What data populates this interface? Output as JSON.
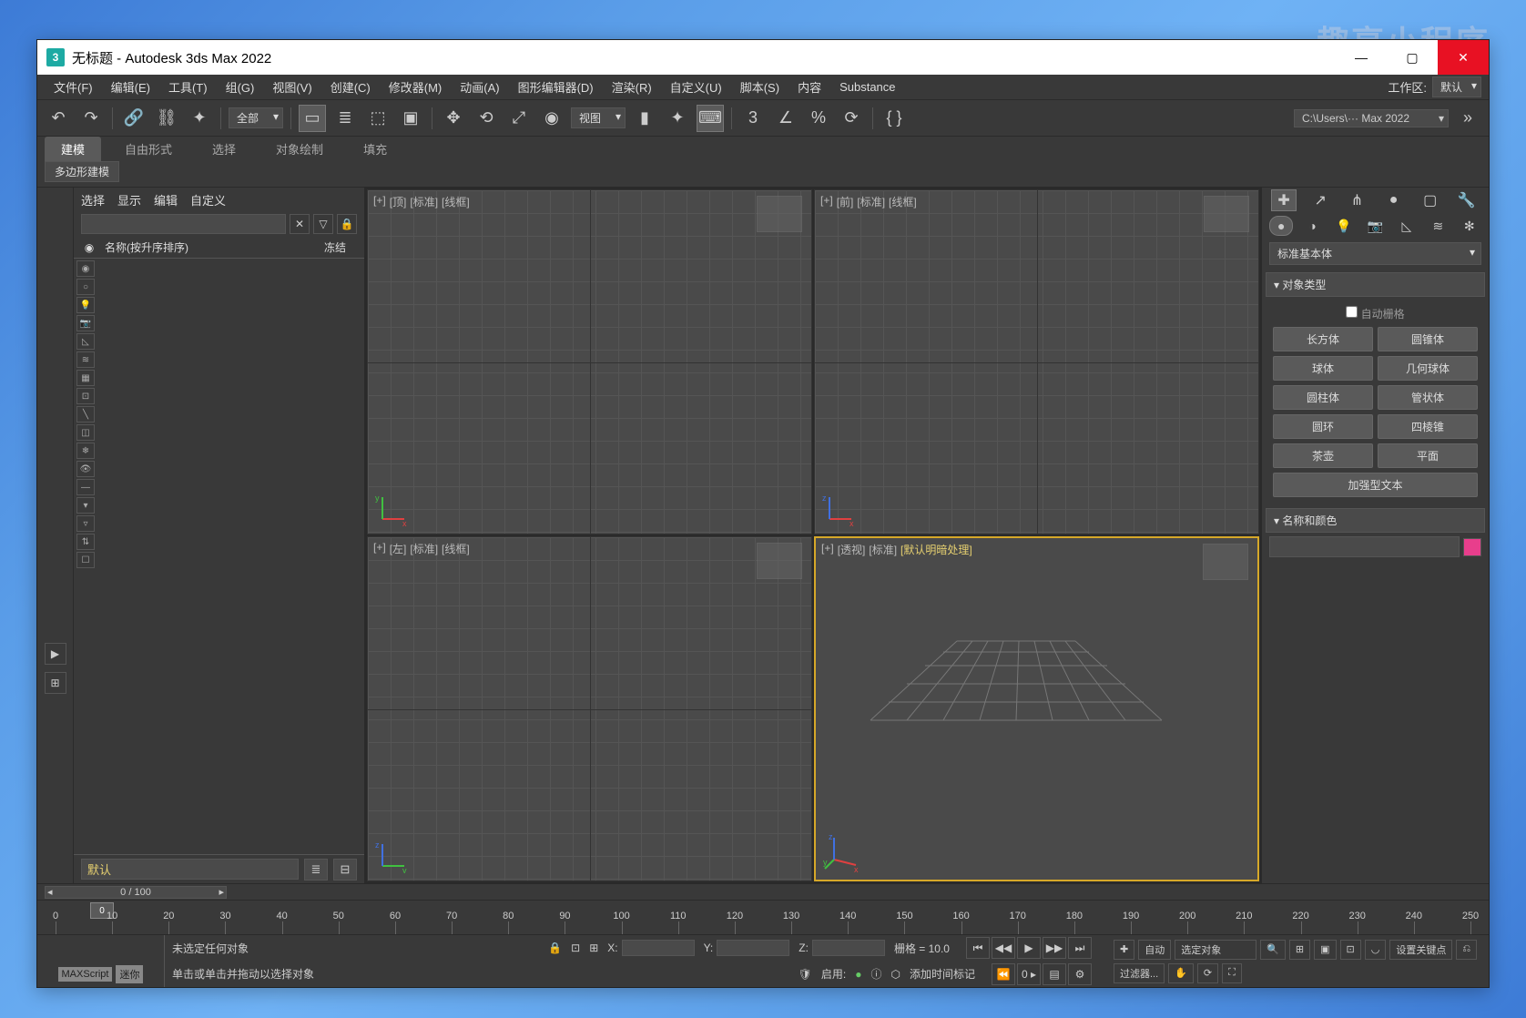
{
  "watermark": "趣享小程序",
  "window": {
    "title": "无标题 - Autodesk 3ds Max 2022"
  },
  "menubar": {
    "items": [
      "文件(F)",
      "编辑(E)",
      "工具(T)",
      "组(G)",
      "视图(V)",
      "创建(C)",
      "修改器(M)",
      "动画(A)",
      "图形编辑器(D)",
      "渲染(R)",
      "自定义(U)",
      "脚本(S)",
      "内容",
      "Substance"
    ],
    "workspace_label": "工作区:",
    "workspace_value": "默认"
  },
  "toolbar": {
    "selection_filter": "全部",
    "ref_coord": "视图",
    "angle_snap": "3",
    "project_path": "C:\\Users\\··· Max 2022"
  },
  "ribbon": {
    "tabs": [
      "建模",
      "自由形式",
      "选择",
      "对象绘制",
      "填充"
    ],
    "subtab": "多边形建模"
  },
  "scene_explorer": {
    "menus": [
      "选择",
      "显示",
      "编辑",
      "自定义"
    ],
    "col_name": "名称(按升序排序)",
    "col_freeze": "冻结",
    "layer_name": "默认"
  },
  "viewports": {
    "top": {
      "plus": "[+]",
      "name": "[顶]",
      "std": "[标准]",
      "shade": "[线框]"
    },
    "front": {
      "plus": "[+]",
      "name": "[前]",
      "std": "[标准]",
      "shade": "[线框]"
    },
    "left": {
      "plus": "[+]",
      "name": "[左]",
      "std": "[标准]",
      "shade": "[线框]"
    },
    "persp": {
      "plus": "[+]",
      "name": "[透视]",
      "std": "[标准]",
      "shade": "[默认明暗处理]"
    }
  },
  "command_panel": {
    "dropdown": "标准基本体",
    "rollout_type": "对象类型",
    "autogrid": "自动栅格",
    "primitives": [
      "长方体",
      "圆锥体",
      "球体",
      "几何球体",
      "圆柱体",
      "管状体",
      "圆环",
      "四棱锥",
      "茶壶",
      "平面",
      "加强型文本"
    ],
    "rollout_name": "名称和颜色"
  },
  "timeline": {
    "frame_label": "0 / 100",
    "slider_value": "0"
  },
  "trackbar": {
    "ticks": [
      0,
      10,
      20,
      30,
      40,
      50,
      60,
      70,
      80,
      90,
      100,
      110,
      120,
      130,
      140,
      150,
      160,
      170,
      180,
      190,
      200,
      210,
      220,
      230,
      240,
      250
    ]
  },
  "status": {
    "maxscript": "MAXScript",
    "mini": "迷你",
    "no_selection": "未选定任何对象",
    "prompt": "单击或单击并拖动以选择对象",
    "x_label": "X:",
    "y_label": "Y:",
    "z_label": "Z:",
    "grid_label": "栅格 = 10.0",
    "enable_label": "启用:",
    "add_time_tag": "添加时间标记",
    "auto_key": "自动",
    "set_key": "设置关键点",
    "selected_obj": "选定对象",
    "key_filters": "过滤器..."
  }
}
